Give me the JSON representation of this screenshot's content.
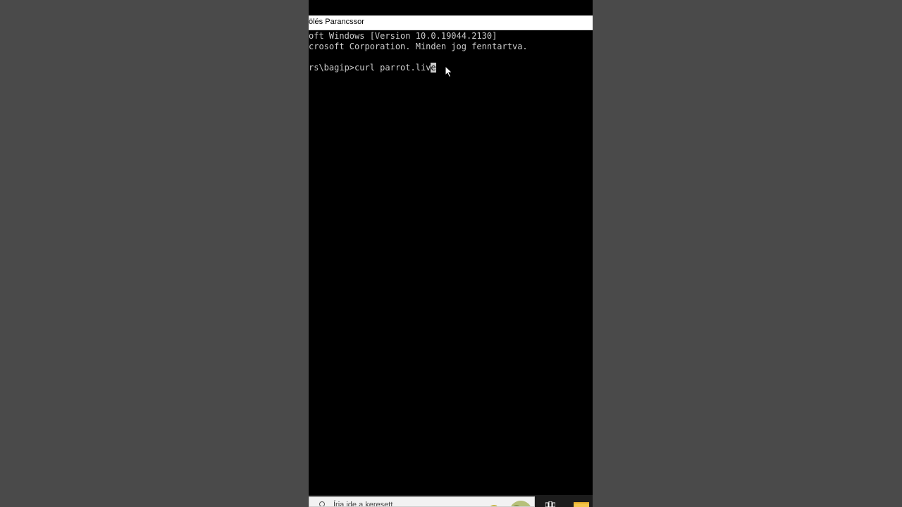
{
  "window": {
    "title": "ölés Parancssor"
  },
  "console": {
    "lines": [
      "oft Windows [Version 10.0.19044.2130]",
      "crosoft Corporation. Minden jog fenntartva."
    ],
    "prompt": "rs\\bagip>",
    "command_typed": "curl parrot.liv",
    "cursor_char": "e"
  },
  "taskbar": {
    "search_placeholder": "Írja ide a keresett",
    "icons": [
      "search-icon",
      "task-view-icon",
      "file-explorer-icon"
    ]
  },
  "colors": {
    "page_bg": "#4a4a4a",
    "console_bg": "#000000",
    "console_fg": "#cccccc",
    "titlebar_bg": "#ffffff",
    "folder": "#f3c54b"
  }
}
